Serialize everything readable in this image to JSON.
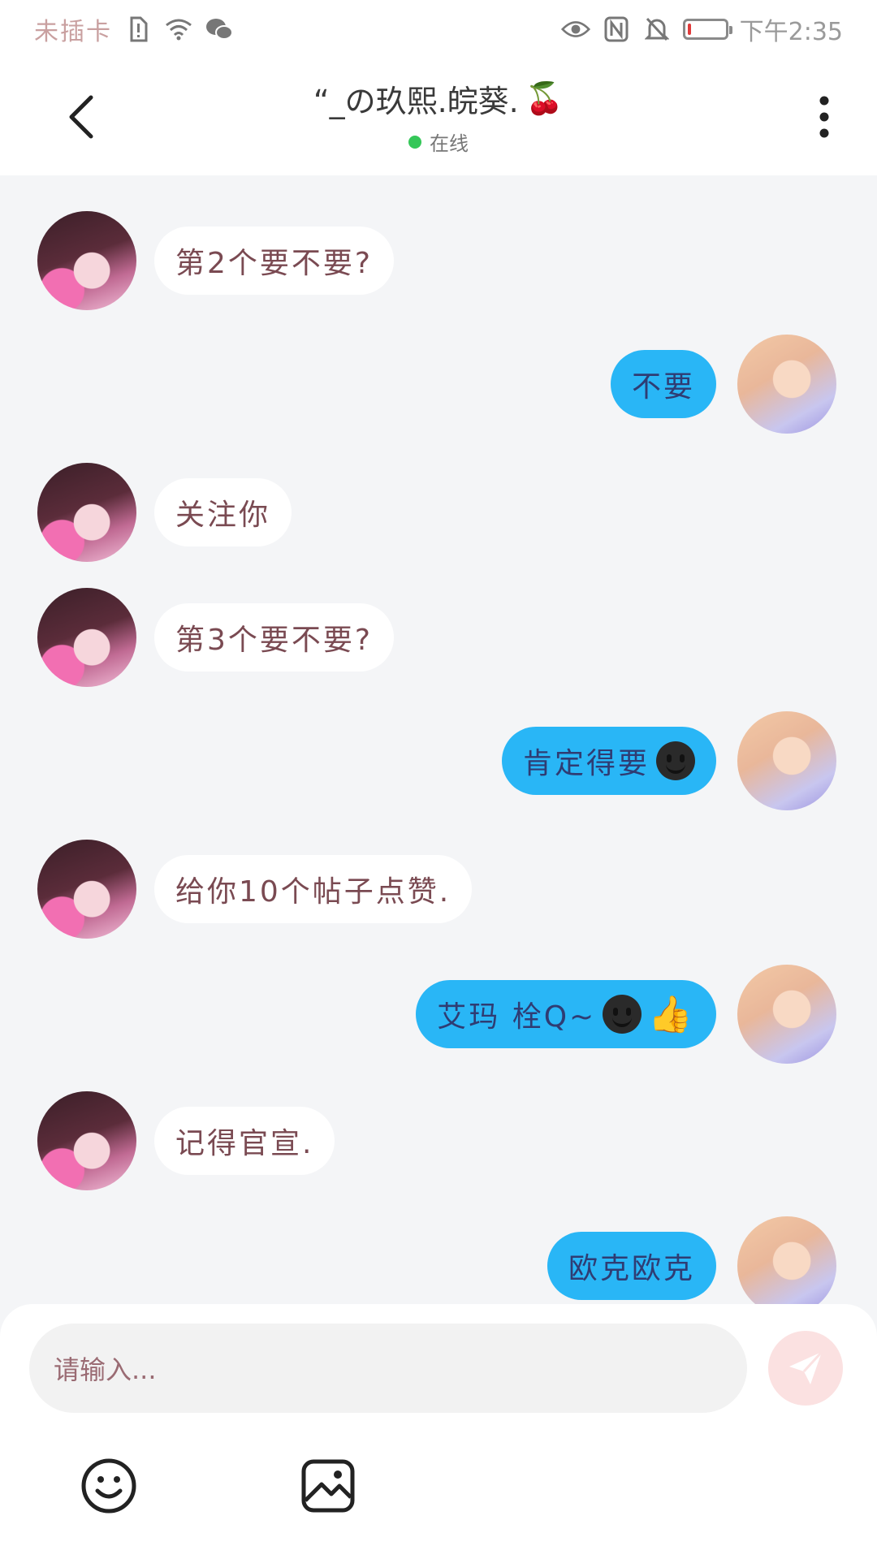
{
  "status_bar": {
    "carrier": "未插卡",
    "time": "下午2:35",
    "icons": [
      "sim-alert-icon",
      "wifi-icon",
      "wechat-icon",
      "eye-icon",
      "nfc-icon",
      "bell-off-icon",
      "battery-icon"
    ],
    "battery_level": 0.1,
    "battery_color": "#e03b3b"
  },
  "header": {
    "title": "“_の玖熙.皖葵.",
    "title_emoji": "🍒",
    "status": "在线",
    "status_color": "#35c759"
  },
  "messages": [
    {
      "side": "left",
      "text": "第2个要不要?"
    },
    {
      "side": "right",
      "text": "不要"
    },
    {
      "side": "left",
      "text": "关注你"
    },
    {
      "side": "left",
      "text": "第3个要不要?"
    },
    {
      "side": "right",
      "text": "肯定得要"
    },
    {
      "side": "left",
      "text": "给你10个帖子点赞."
    },
    {
      "side": "right",
      "text": "艾玛 栓Q~"
    },
    {
      "side": "left",
      "text": "记得官宣."
    },
    {
      "side": "right",
      "text": "欧克欧克"
    }
  ],
  "input": {
    "placeholder": "请输入..."
  },
  "toolbar": {
    "icons": [
      "emoji-icon",
      "image-icon"
    ]
  },
  "colors": {
    "my_bubble": "#29b6f6",
    "their_bubble": "#ffffff",
    "send_button": "#fbe1e1"
  }
}
